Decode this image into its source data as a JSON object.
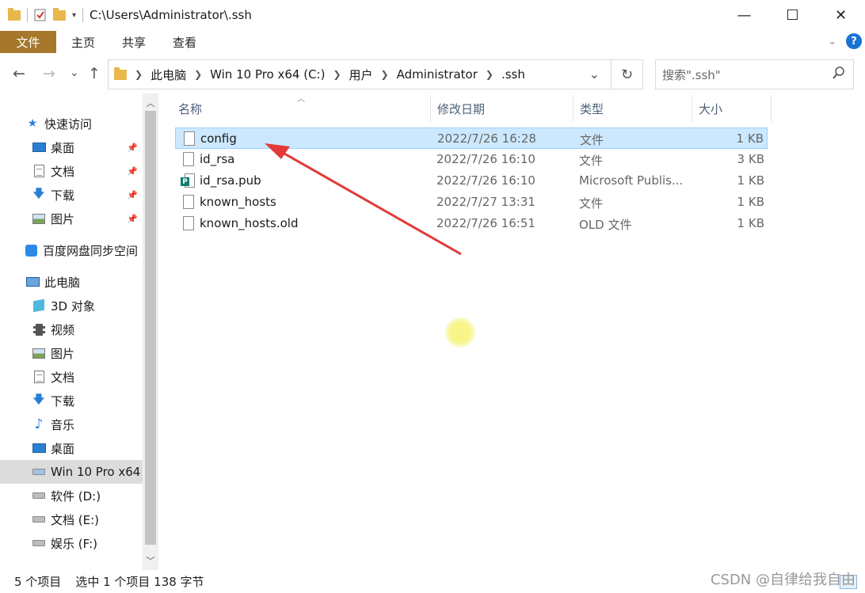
{
  "window": {
    "title": "C:\\Users\\Administrator\\.ssh",
    "controls": {
      "minimize": "—",
      "maximize": "☐",
      "close": "✕"
    }
  },
  "ribbon": {
    "tabs": [
      "文件",
      "主页",
      "共享",
      "查看"
    ],
    "help": "?"
  },
  "nav": {
    "back": "←",
    "forward": "→",
    "recent": "⌄",
    "up": "↑"
  },
  "address": {
    "crumbs": [
      "此电脑",
      "Win 10 Pro x64 (C:)",
      "用户",
      "Administrator",
      ".ssh"
    ],
    "dropdown": "⌄",
    "refresh": "↻"
  },
  "search": {
    "placeholder": "搜索\".ssh\"",
    "icon": "search-icon"
  },
  "sidebar": {
    "items": [
      {
        "label": "快速访问",
        "icon": "star-icon",
        "pinned": false
      },
      {
        "label": "桌面",
        "icon": "desktop-icon",
        "pinned": true
      },
      {
        "label": "文档",
        "icon": "documents-icon",
        "pinned": true
      },
      {
        "label": "下载",
        "icon": "downloads-icon",
        "pinned": true
      },
      {
        "label": "图片",
        "icon": "pictures-icon",
        "pinned": true
      },
      {
        "label": "百度网盘同步空间",
        "icon": "baidu-netdisk-icon",
        "pinned": false
      },
      {
        "label": "此电脑",
        "icon": "this-pc-icon",
        "pinned": false
      },
      {
        "label": "3D 对象",
        "icon": "3d-objects-icon",
        "pinned": false
      },
      {
        "label": "视频",
        "icon": "videos-icon",
        "pinned": false
      },
      {
        "label": "图片",
        "icon": "pictures-icon",
        "pinned": false
      },
      {
        "label": "文档",
        "icon": "documents-icon",
        "pinned": false
      },
      {
        "label": "下载",
        "icon": "downloads-icon",
        "pinned": false
      },
      {
        "label": "音乐",
        "icon": "music-icon",
        "pinned": false
      },
      {
        "label": "桌面",
        "icon": "desktop-icon",
        "pinned": false
      },
      {
        "label": "Win 10 Pro x64",
        "icon": "windows-drive-icon",
        "pinned": false
      },
      {
        "label": "软件 (D:)",
        "icon": "drive-icon",
        "pinned": false
      },
      {
        "label": "文档 (E:)",
        "icon": "drive-icon",
        "pinned": false
      },
      {
        "label": "娱乐 (F:)",
        "icon": "drive-icon",
        "pinned": false
      }
    ],
    "selected_index": 14
  },
  "columns": [
    "名称",
    "修改日期",
    "类型",
    "大小"
  ],
  "files": [
    {
      "name": "config",
      "date": "2022/7/26 16:28",
      "type": "文件",
      "size": "1 KB",
      "icon": "file-icon"
    },
    {
      "name": "id_rsa",
      "date": "2022/7/26 16:10",
      "type": "文件",
      "size": "3 KB",
      "icon": "file-icon"
    },
    {
      "name": "id_rsa.pub",
      "date": "2022/7/26 16:10",
      "type": "Microsoft Publis...",
      "size": "1 KB",
      "icon": "publisher-file-icon"
    },
    {
      "name": "known_hosts",
      "date": "2022/7/27 13:31",
      "type": "文件",
      "size": "1 KB",
      "icon": "file-icon"
    },
    {
      "name": "known_hosts.old",
      "date": "2022/7/26 16:51",
      "type": "OLD 文件",
      "size": "1 KB",
      "icon": "file-icon"
    }
  ],
  "selected_file_index": 0,
  "status": {
    "count": "5 个项目",
    "selection": "选中 1 个项目  138 字节"
  },
  "watermark": "CSDN @自律给我自由",
  "annotation_color": "#e23a3a"
}
